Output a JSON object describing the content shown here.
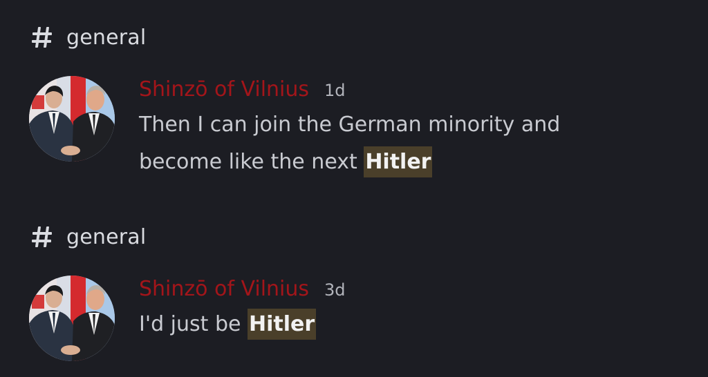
{
  "results": [
    {
      "channel": "general",
      "author": "Shinzō of Vilnius",
      "time": "1d",
      "text_before_line1": "Then I can join the German minority and",
      "text_before_line2": "become like the next ",
      "highlight": "Hitler"
    },
    {
      "channel": "general",
      "author": "Shinzō of Vilnius",
      "time": "3d",
      "text_before": "I'd just be ",
      "highlight": "Hitler"
    }
  ],
  "colors": {
    "background": "#1c1d23",
    "username": "#a3151a",
    "highlight_bg": "#4a3f2a",
    "text": "#c9cbd1"
  },
  "icons": {
    "channel": "hashtag-icon"
  }
}
